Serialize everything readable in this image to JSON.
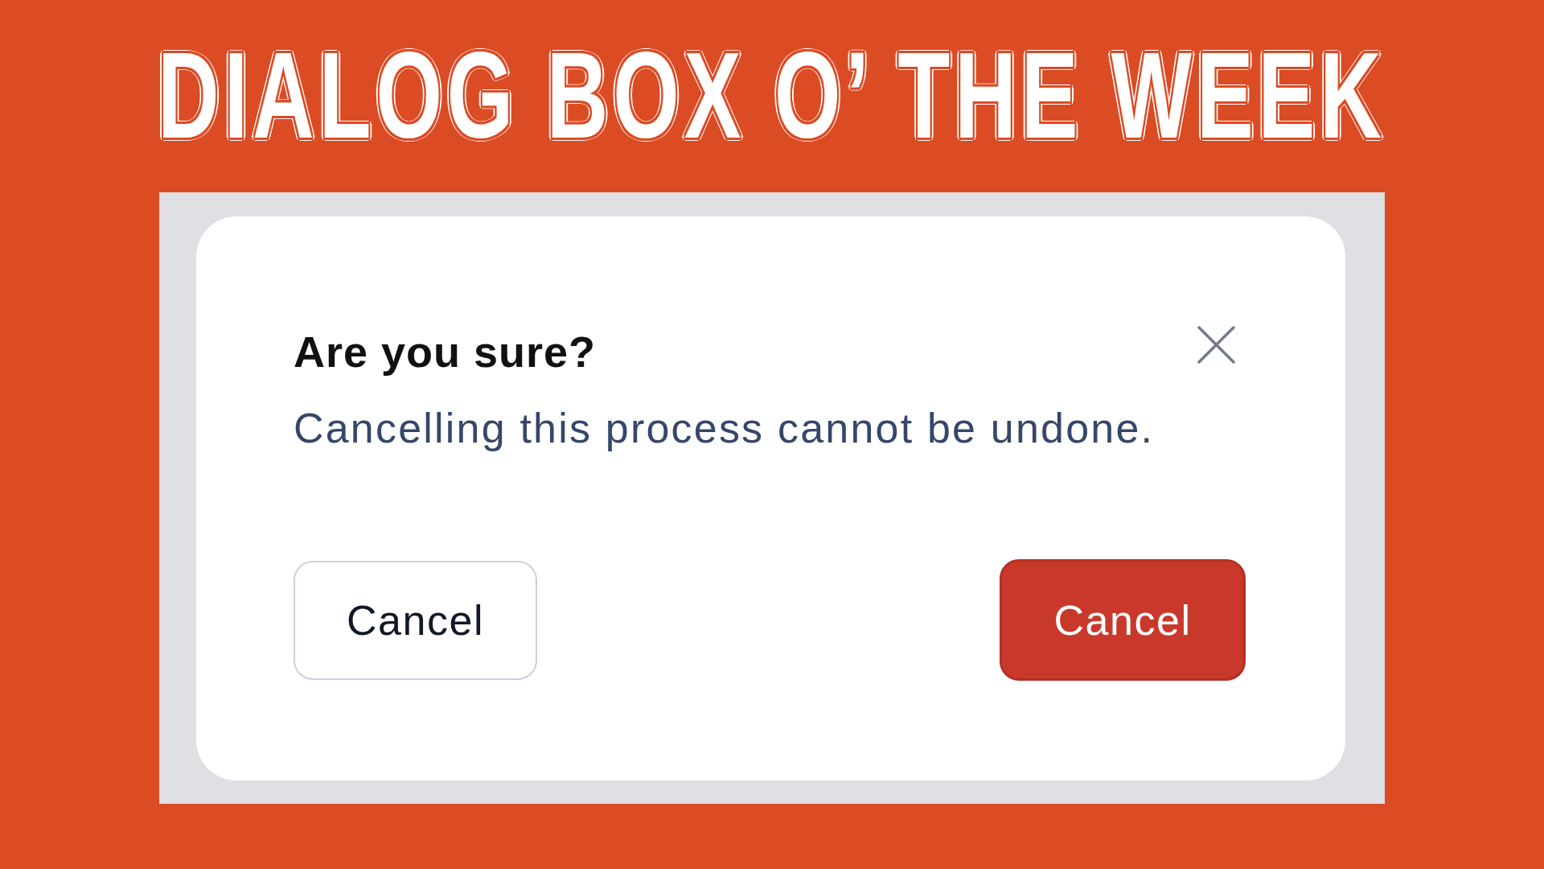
{
  "banner": {
    "title": "DIALOG BOX O’ THE WEEK"
  },
  "dialog": {
    "title": "Are you sure?",
    "message": "Cancelling this process cannot be undone.",
    "buttons": [
      {
        "label": "Cancel",
        "kind": "outline"
      },
      {
        "label": "Cancel",
        "kind": "danger"
      }
    ]
  }
}
